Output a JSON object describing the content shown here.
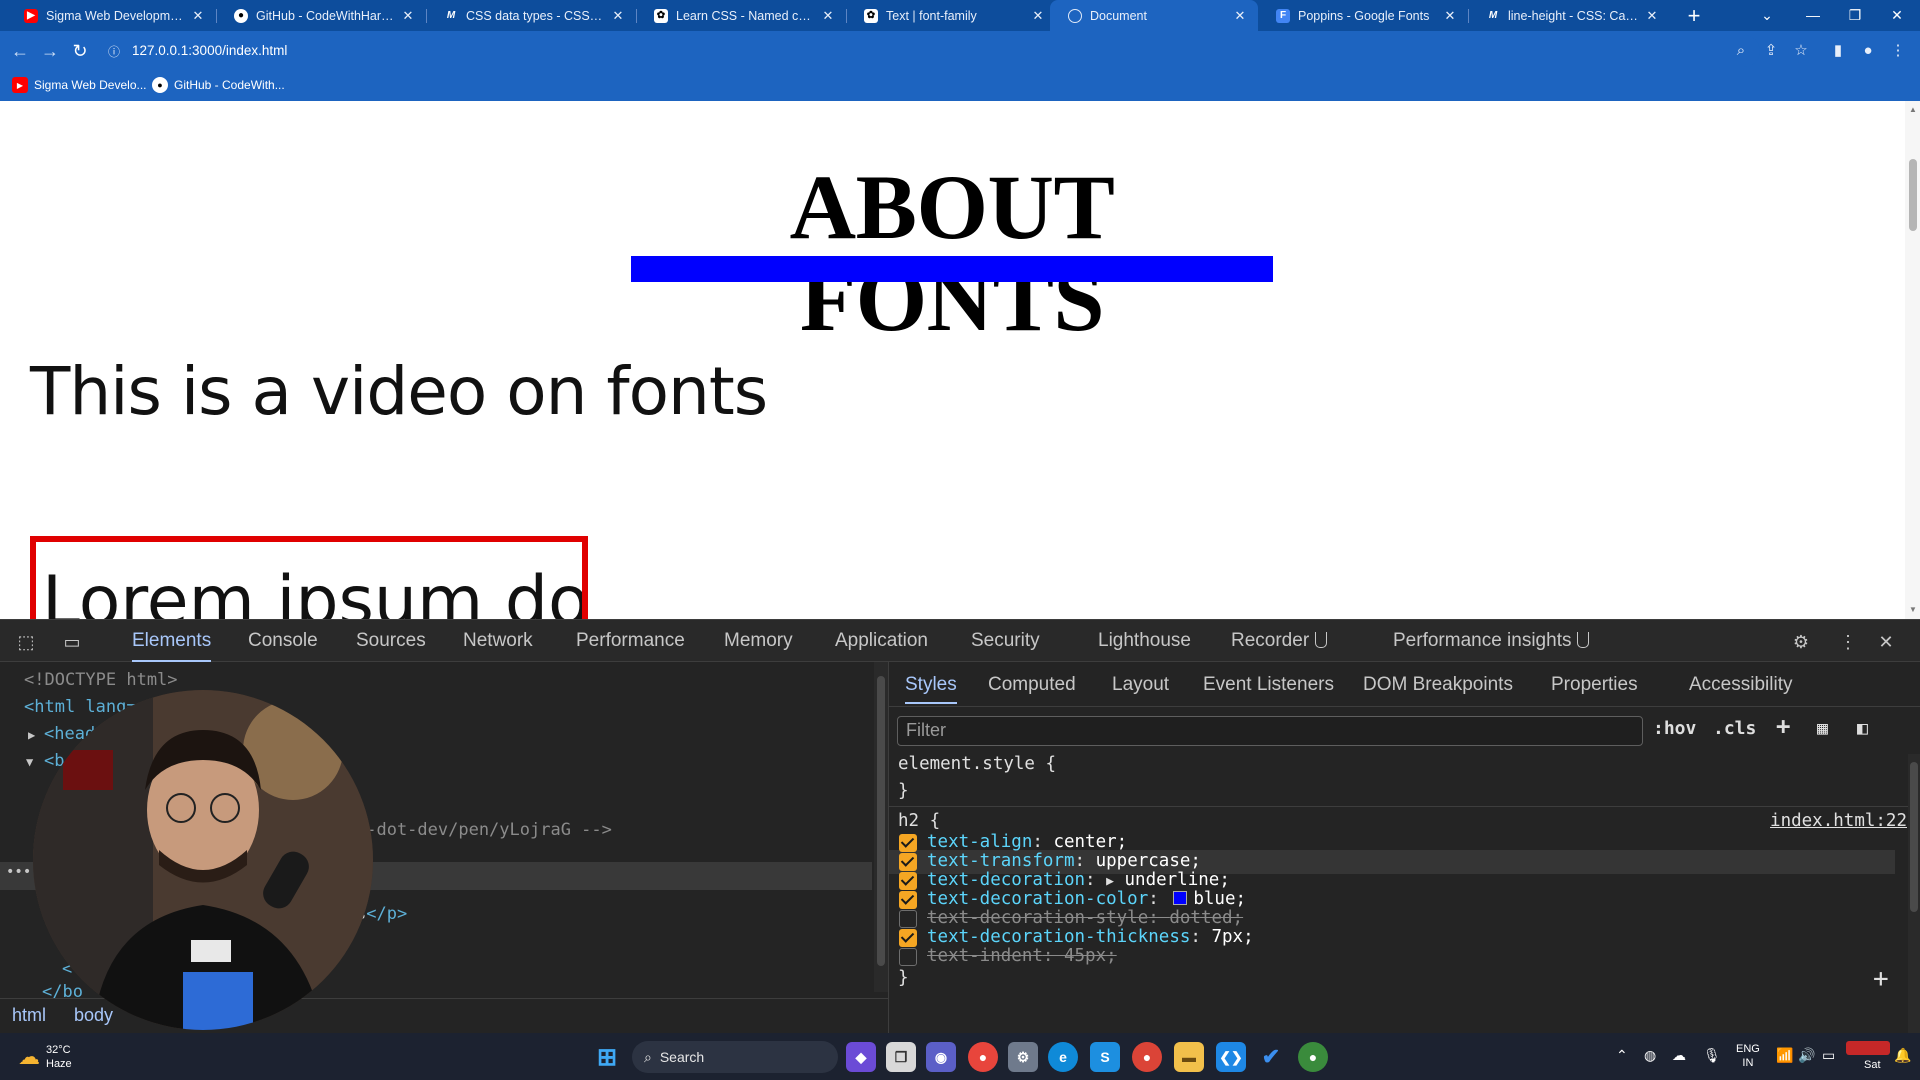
{
  "browser": {
    "tabs": [
      {
        "title": "Sigma Web Development Co",
        "favicon": "youtube-icon",
        "active": false
      },
      {
        "title": "GitHub - CodeWithHarry/Sig",
        "favicon": "github-icon",
        "active": false
      },
      {
        "title": "CSS data types - CSS: Cascad",
        "favicon": "mdn-icon",
        "active": false
      },
      {
        "title": "Learn CSS - Named colors",
        "favicon": "openai-icon",
        "active": false
      },
      {
        "title": "Text | font-family",
        "favicon": "chatgpt-icon",
        "active": false
      },
      {
        "title": "Document",
        "favicon": "globe-icon",
        "active": true
      },
      {
        "title": "Poppins - Google Fonts",
        "favicon": "google-fonts-icon",
        "active": false
      },
      {
        "title": "line-height - CSS: Cascading",
        "favicon": "mdn-icon",
        "active": false
      }
    ],
    "url": "127.0.0.1:3000/index.html",
    "bookmarks": [
      {
        "label": "Sigma Web Develo...",
        "icon": "youtube-icon"
      },
      {
        "label": "GitHub - CodeWith...",
        "icon": "github-icon"
      }
    ],
    "accent": "#1d64c0"
  },
  "page": {
    "heading": "ABOUT FONTS",
    "paragraph": "This is a video on fonts",
    "lorem": "Lorem ipsum dol",
    "underline_color": "#0000ff",
    "box_color": "#e00000"
  },
  "devtools": {
    "tabs": [
      "Elements",
      "Console",
      "Sources",
      "Network",
      "Performance",
      "Memory",
      "Application",
      "Security",
      "Lighthouse",
      "Recorder",
      "Performance insights"
    ],
    "active_tab": "Elements",
    "elements": {
      "doctype": "<!DOCTYPE html>",
      "html_open": "<html lang=",
      "head": "<head",
      "body": "<b",
      "comment_tail": "o-dot-dev/pen/yLojraG -->",
      "p_tail": "s",
      "p_close": "</p>",
      "close_tag": "<",
      "body_close": "</bo"
    },
    "breadcrumbs": [
      "html",
      "body"
    ],
    "styles_tabs": [
      "Styles",
      "Computed",
      "Layout",
      "Event Listeners",
      "DOM Breakpoints",
      "Properties",
      "Accessibility"
    ],
    "filter_placeholder": "Filter",
    "hov": ":hov",
    "cls": ".cls",
    "element_style": "element.style {",
    "close_brace": "}",
    "rule_selector": "h2 {",
    "rule_source": "index.html:22",
    "properties": [
      {
        "name": "text-align",
        "value": "center;",
        "enabled": true
      },
      {
        "name": "text-transform",
        "value": "uppercase;",
        "enabled": true
      },
      {
        "name": "text-decoration",
        "value": "underline;",
        "enabled": true,
        "expandable": true
      },
      {
        "name": "text-decoration-color",
        "value": "blue;",
        "enabled": true,
        "swatch": "#0000ff"
      },
      {
        "name": "text-decoration-style",
        "value": "dotted;",
        "enabled": false
      },
      {
        "name": "text-decoration-thickness",
        "value": "7px;",
        "enabled": true
      },
      {
        "name": "text-indent",
        "value": "45px;",
        "enabled": false
      }
    ]
  },
  "taskbar": {
    "weather_temp": "32°C",
    "weather_desc": "Haze",
    "search_label": "Search",
    "lang_top": "ENG",
    "lang_bottom": "IN",
    "day": "Sat"
  }
}
